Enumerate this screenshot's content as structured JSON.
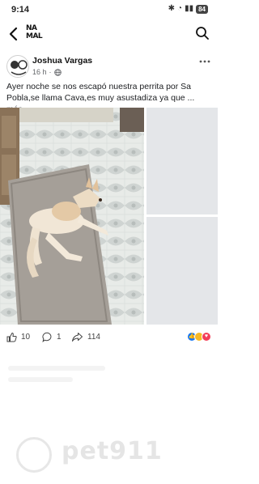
{
  "status_bar": {
    "time": "9:14",
    "battery": "84"
  },
  "header": {
    "logo_line1": "NA",
    "logo_line2": "MAL"
  },
  "post": {
    "author": "Joshua Vargas",
    "time": "16 h",
    "text": "Ayer noche se nos escapó nuestra perrita por Sa Pobla,se llama Cava,es muy asustadiza ya que ...",
    "see_more": "más",
    "likes": "10",
    "comments": "1",
    "shares": "114"
  },
  "watermark": {
    "brand": "pet911"
  },
  "colors": {
    "text": "#1c1e21",
    "meta": "#65676b",
    "like_blue": "#1877f2",
    "haha_yellow": "#f7b928",
    "love_red": "#f33e58"
  }
}
